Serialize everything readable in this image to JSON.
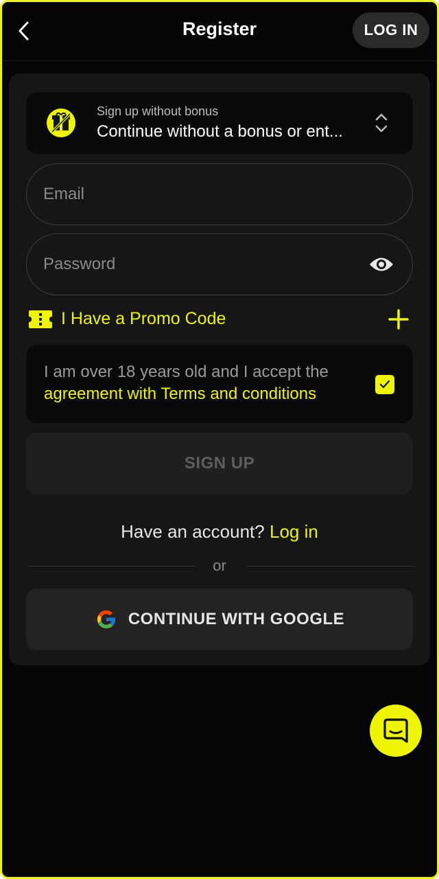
{
  "header": {
    "title": "Register",
    "login_label": "LOG IN"
  },
  "bonus": {
    "subtitle": "Sign up without bonus",
    "selected": "Continue without a bonus or ent..."
  },
  "form": {
    "email_placeholder": "Email",
    "password_placeholder": "Password"
  },
  "promo": {
    "label": "I Have a Promo Code"
  },
  "terms": {
    "text": "I am over 18 years old and I accept the",
    "link": "agreement with Terms and conditions",
    "checked": true
  },
  "signup": {
    "label": "SIGN UP"
  },
  "account": {
    "prompt": "Have an account?",
    "link": "Log in"
  },
  "divider": {
    "text": "or"
  },
  "google": {
    "label": "CONTINUE WITH GOOGLE"
  },
  "colors": {
    "accent": "#eef500",
    "background": "#050505",
    "card": "#161616"
  },
  "icons": {
    "back": "chevron-left-icon",
    "bonus": "no-gift-icon",
    "chevron": "chevron-up-down-icon",
    "eye": "eye-icon",
    "ticket": "ticket-icon",
    "plus": "plus-icon",
    "check": "check-icon",
    "google": "google-icon",
    "chat": "chat-icon"
  }
}
